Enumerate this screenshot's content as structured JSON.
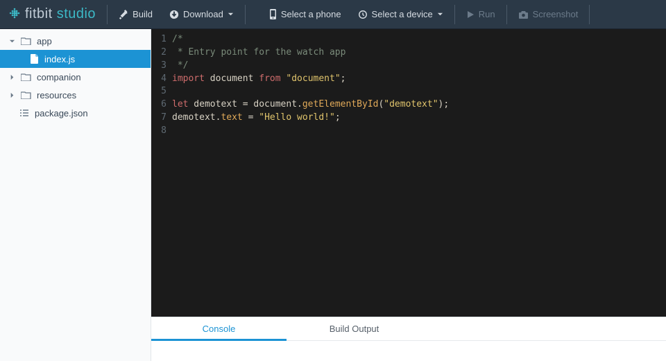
{
  "header": {
    "brand_fitbit": "fitbit",
    "brand_studio": "studio",
    "build_label": "Build",
    "download_label": "Download",
    "select_phone_label": "Select a phone",
    "select_device_label": "Select a device",
    "run_label": "Run",
    "screenshot_label": "Screenshot"
  },
  "sidebar": {
    "items": [
      {
        "label": "app",
        "type": "folder",
        "expanded": true
      },
      {
        "label": "index.js",
        "type": "file",
        "selected": true
      },
      {
        "label": "companion",
        "type": "folder",
        "expanded": false
      },
      {
        "label": "resources",
        "type": "folder",
        "expanded": false
      },
      {
        "label": "package.json",
        "type": "file-root"
      }
    ]
  },
  "editor": {
    "filename": "index.js",
    "lines": [
      {
        "n": "1",
        "raw": "/*"
      },
      {
        "n": "2",
        "raw": " * Entry point for the watch app"
      },
      {
        "n": "3",
        "raw": " */"
      },
      {
        "n": "4",
        "raw": "import document from \"document\";"
      },
      {
        "n": "5",
        "raw": ""
      },
      {
        "n": "6",
        "raw": "let demotext = document.getElementById(\"demotext\");"
      },
      {
        "n": "7",
        "raw": "demotext.text = \"Hello world!\";"
      },
      {
        "n": "8",
        "raw": ""
      }
    ]
  },
  "bottom_tabs": {
    "console": "Console",
    "build_output": "Build Output",
    "active": "console"
  }
}
